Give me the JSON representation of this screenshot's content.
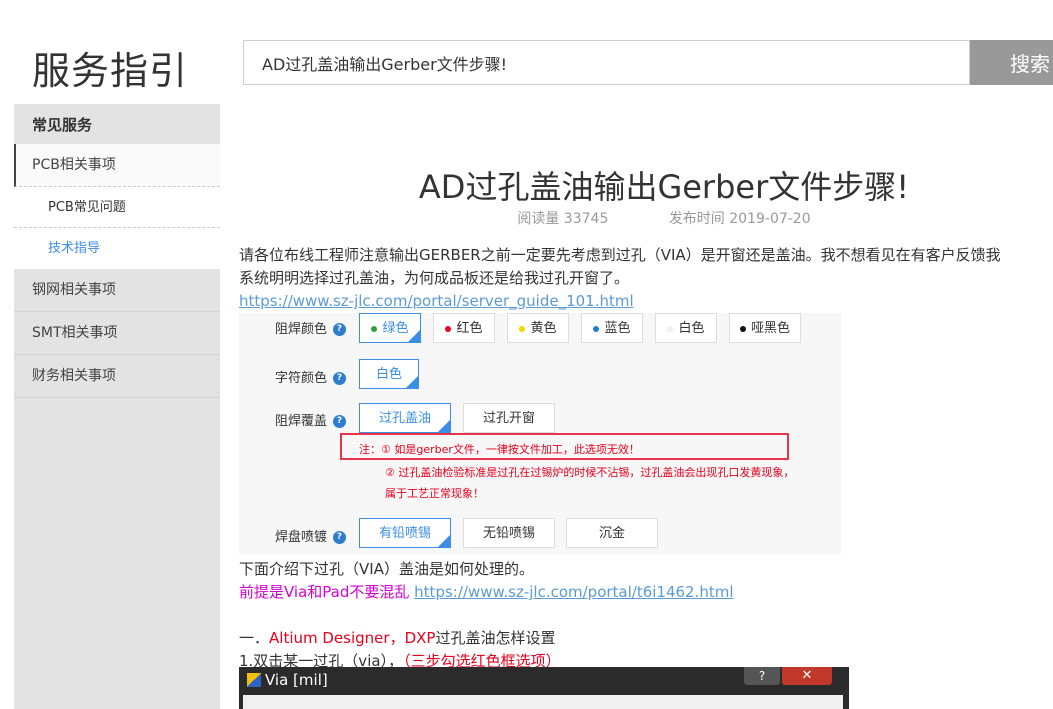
{
  "header": {
    "site_title": "服务指引",
    "search_value": "AD过孔盖油输出Gerber文件步骤!",
    "search_button": "搜索"
  },
  "sidebar": {
    "heading": "常见服务",
    "items": [
      {
        "label": "PCB相关事项",
        "active": true
      },
      {
        "label": "PCB常见问题",
        "sub": true
      },
      {
        "label": "技术指导",
        "sub": true,
        "current": true
      },
      {
        "label": "钢网相关事项"
      },
      {
        "label": "SMT相关事项"
      },
      {
        "label": "财务相关事项"
      }
    ]
  },
  "article": {
    "title": "AD过孔盖油输出Gerber文件步骤!",
    "reads": "阅读量 33745",
    "published": "发布时间 2019-07-20",
    "para1_line1": "请各位布线工程师注意输出GERBER之前一定要先考虑到过孔（VIA）是开窗还是盖油。我不想看见在有客户反馈我",
    "para1_line2": "系统明明选择过孔盖油，为何成品板还是给我过孔开窗了。",
    "link1": "https://www.sz-jlc.com/portal/server_guide_101.html",
    "para2": "下面介绍下过孔（VIA）盖油是如何处理的。",
    "premise": "前提是Via和Pad不要混乱",
    "link2": "https://www.sz-jlc.com/portal/t6i1462.html",
    "section1_prefix": "一．",
    "section1_red": "Altium Designer，DXP",
    "section1_suffix": "过孔盖油怎样设置",
    "step1_prefix": "1.双击某一过孔（via），",
    "step1_red": "（三步勾选红色框选项）"
  },
  "screenshot1": {
    "rows": [
      {
        "label": "阻焊颜色"
      },
      {
        "label": "字符颜色"
      },
      {
        "label": "阻焊覆盖"
      },
      {
        "label": "焊盘喷镀"
      }
    ],
    "solder_colors": [
      {
        "label": "绿色",
        "color": "#2e9e3e"
      },
      {
        "label": "红色",
        "color": "#e8001c"
      },
      {
        "label": "黄色",
        "color": "#f5d800"
      },
      {
        "label": "蓝色",
        "color": "#1a7fe0"
      },
      {
        "label": "白色",
        "color": "#f0f0f0"
      },
      {
        "label": "哑黑色",
        "color": "#111111"
      }
    ],
    "silk_color": "白色",
    "cover_options": [
      "过孔盖油",
      "过孔开窗"
    ],
    "note1": "注：① 如是gerber文件，一律按文件加工，此选项无效！",
    "note2": "② 过孔盖油检验标准是过孔在过锡炉的时候不沾锡，过孔盖油会出现孔口发黄现象，",
    "note3": "属于工艺正常现象！",
    "finish_options": [
      "有铅喷锡",
      "无铅喷锡",
      "沉金"
    ]
  },
  "screenshot2": {
    "window_title": "Via [mil]",
    "help": "?",
    "close": "✕"
  }
}
